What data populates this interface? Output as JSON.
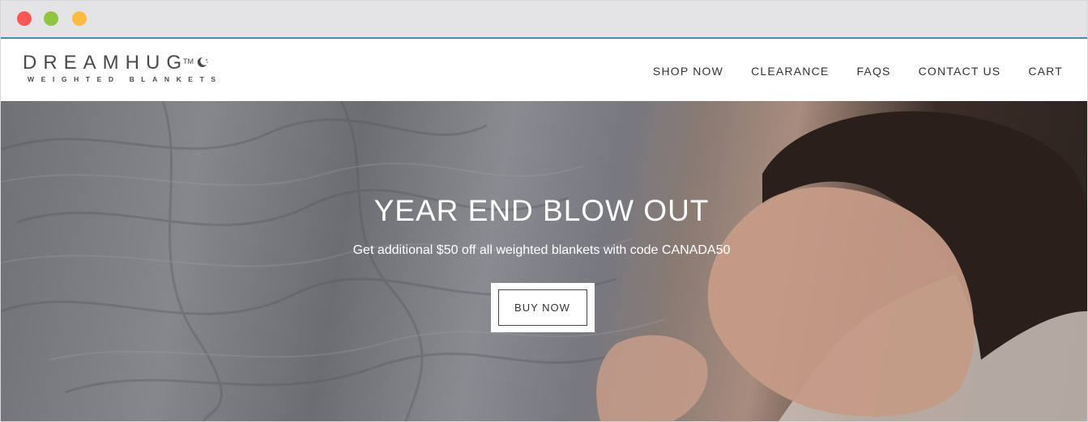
{
  "window": {
    "controls": [
      "close",
      "minimize",
      "maximize"
    ]
  },
  "header": {
    "logo": {
      "main": "DREAMHUG",
      "tm": "TM",
      "sub": "WEIGHTED BLANKETS",
      "icon": "moon-icon"
    },
    "nav": [
      {
        "label": "SHOP NOW"
      },
      {
        "label": "CLEARANCE"
      },
      {
        "label": "FAQS"
      },
      {
        "label": "CONTACT US"
      },
      {
        "label": "CART"
      }
    ]
  },
  "hero": {
    "title": "YEAR END BLOW OUT",
    "subtitle": "Get additional $50 off all weighted blankets with code CANADA50",
    "button_label": "BUY NOW"
  },
  "colors": {
    "accent": "#3d8fbe",
    "close": "#fc5753",
    "minimize": "#8ec63f",
    "maximize": "#fdbc40"
  }
}
